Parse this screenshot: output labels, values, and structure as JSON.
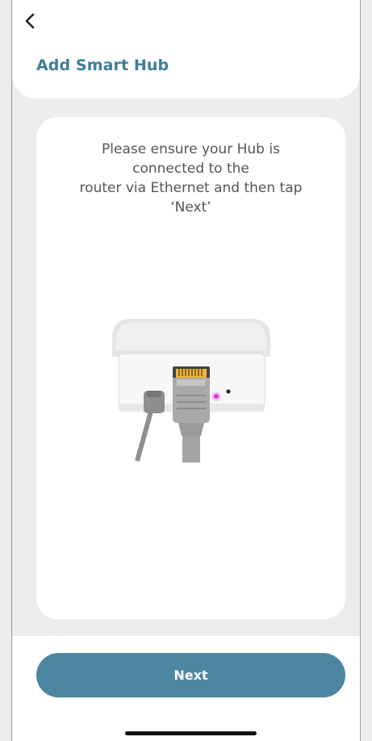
{
  "header": {
    "back_icon": "chevron-left-icon",
    "title": "Add Smart Hub"
  },
  "card": {
    "instruction": "Please ensure your Hub is\nconnected to the\nrouter via Ethernet and then tap\n‘Next’",
    "illustration_icon": "smart-hub-ethernet-illustration"
  },
  "footer": {
    "next_label": "Next"
  },
  "colors": {
    "accent": "#3d7e9a",
    "button": "#4d86a1",
    "background": "#ececea",
    "indicator_led": "#d63ad1"
  }
}
